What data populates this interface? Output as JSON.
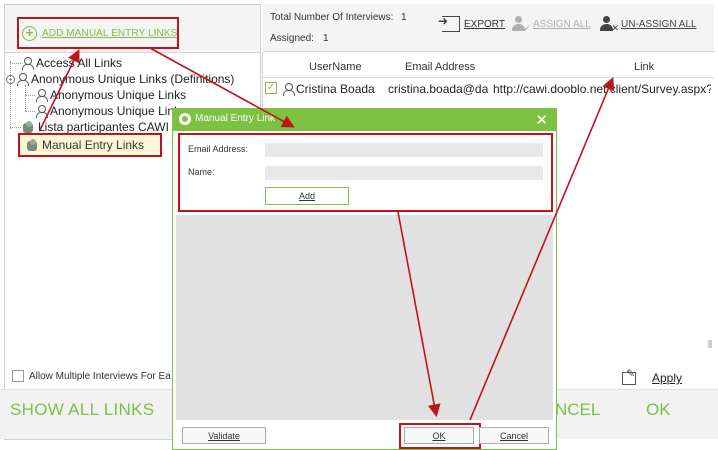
{
  "left_panel": {
    "add_links_label": "ADD MANUAL ENTRY LINKS",
    "tree": [
      {
        "label": "Access All Links",
        "icon": "person-icon"
      },
      {
        "label": "Anonymous Unique Links (Definitions)",
        "icon": "person-icon",
        "expander": "-"
      },
      {
        "label": "Anonymous Unique Links",
        "icon": "person-icon"
      },
      {
        "label": "Anonymous Unique Links",
        "icon": "person-icon"
      },
      {
        "label": "Lista participantes CAWI R",
        "icon": "group-icon"
      },
      {
        "label": "Manual Entry Links",
        "icon": "group-icon"
      }
    ],
    "allow_multiple_label": "Allow Multiple Interviews For Ea"
  },
  "header": {
    "total_label": "Total Number Of Interviews:",
    "total_value": "1",
    "assigned_label": "Assigned:",
    "assigned_value": "1",
    "export_label": "EXPORT",
    "assign_all_label": "ASSIGN ALL",
    "unassign_all_label": "UN-ASSIGN ALL"
  },
  "grid": {
    "columns": [
      "UserName",
      "Email Address",
      "Link"
    ],
    "rows": [
      {
        "checked": "✓",
        "username": "Cristina Boada",
        "email": "cristina.boada@dat",
        "link": "http://cawi.dooblo.net/client/Survey.aspx?"
      }
    ]
  },
  "apply_label": "Apply",
  "bottom": {
    "show_all_links": "SHOW ALL LINKS",
    "cancel": "NCEL",
    "ok": "OK"
  },
  "modal": {
    "title": "Manual Entry Link",
    "close": "✕",
    "email_label": "Email Address:",
    "email_value": "",
    "name_label": "Name:",
    "name_value": "",
    "add_label": "Add",
    "validate_label": "Validate",
    "ok_label": "OK",
    "cancel_label": "Cancel"
  },
  "colors": {
    "accent_green": "#7dc142",
    "annotation_red": "#c0141c"
  }
}
